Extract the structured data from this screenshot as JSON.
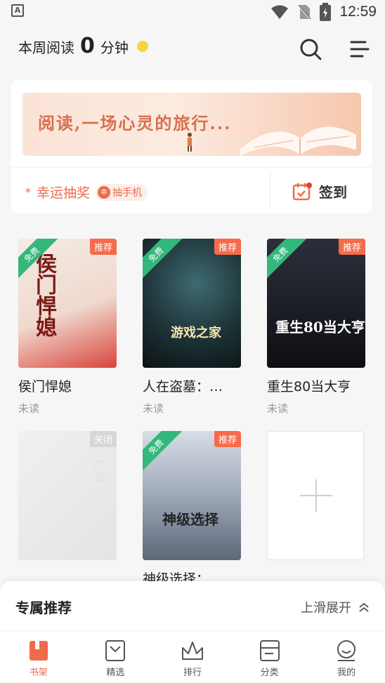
{
  "status_bar": {
    "carrier_icon": "A",
    "time": "12:59"
  },
  "header": {
    "reading_prefix": "本周阅读",
    "reading_minutes": "0",
    "reading_suffix": "分钟"
  },
  "banner": {
    "text": "阅读,一场心灵的旅行..."
  },
  "lucky_draw": {
    "label": "幸运抽奖",
    "badge": "抽手机"
  },
  "sign_in": {
    "label": "签到"
  },
  "books": [
    {
      "title": "侯门悍媳",
      "status": "未读",
      "tag": "推荐",
      "ribbon": "免费",
      "cover_text": "侯门悍媳"
    },
    {
      "title": "人在盗墓：…",
      "status": "未读",
      "tag": "推荐",
      "ribbon": "免费",
      "cover_text": "游戏之家"
    },
    {
      "title": "重生80当大亨",
      "status": "未读",
      "tag": "推荐",
      "ribbon": "免费",
      "cover_text": "重生80当大亨"
    },
    {
      "title": "神级选择：",
      "status": "",
      "tag": "推荐",
      "ribbon": "免费",
      "cover_text": "神级选择"
    }
  ],
  "ad_card": {
    "close_label": "关闭",
    "watermark": "广告"
  },
  "recommend_sheet": {
    "title": "专属推荐",
    "expand_label": "上滑展开"
  },
  "bottom_nav": [
    {
      "label": "书架",
      "icon": "bookshelf-icon",
      "active": true
    },
    {
      "label": "精选",
      "icon": "featured-icon",
      "active": false
    },
    {
      "label": "排行",
      "icon": "crown-icon",
      "active": false
    },
    {
      "label": "分类",
      "icon": "category-icon",
      "active": false
    },
    {
      "label": "我的",
      "icon": "profile-icon",
      "active": false
    }
  ],
  "colors": {
    "accent": "#f06a4c",
    "free_ribbon": "#33b77a",
    "recommend_tag": "#f76a4a"
  }
}
